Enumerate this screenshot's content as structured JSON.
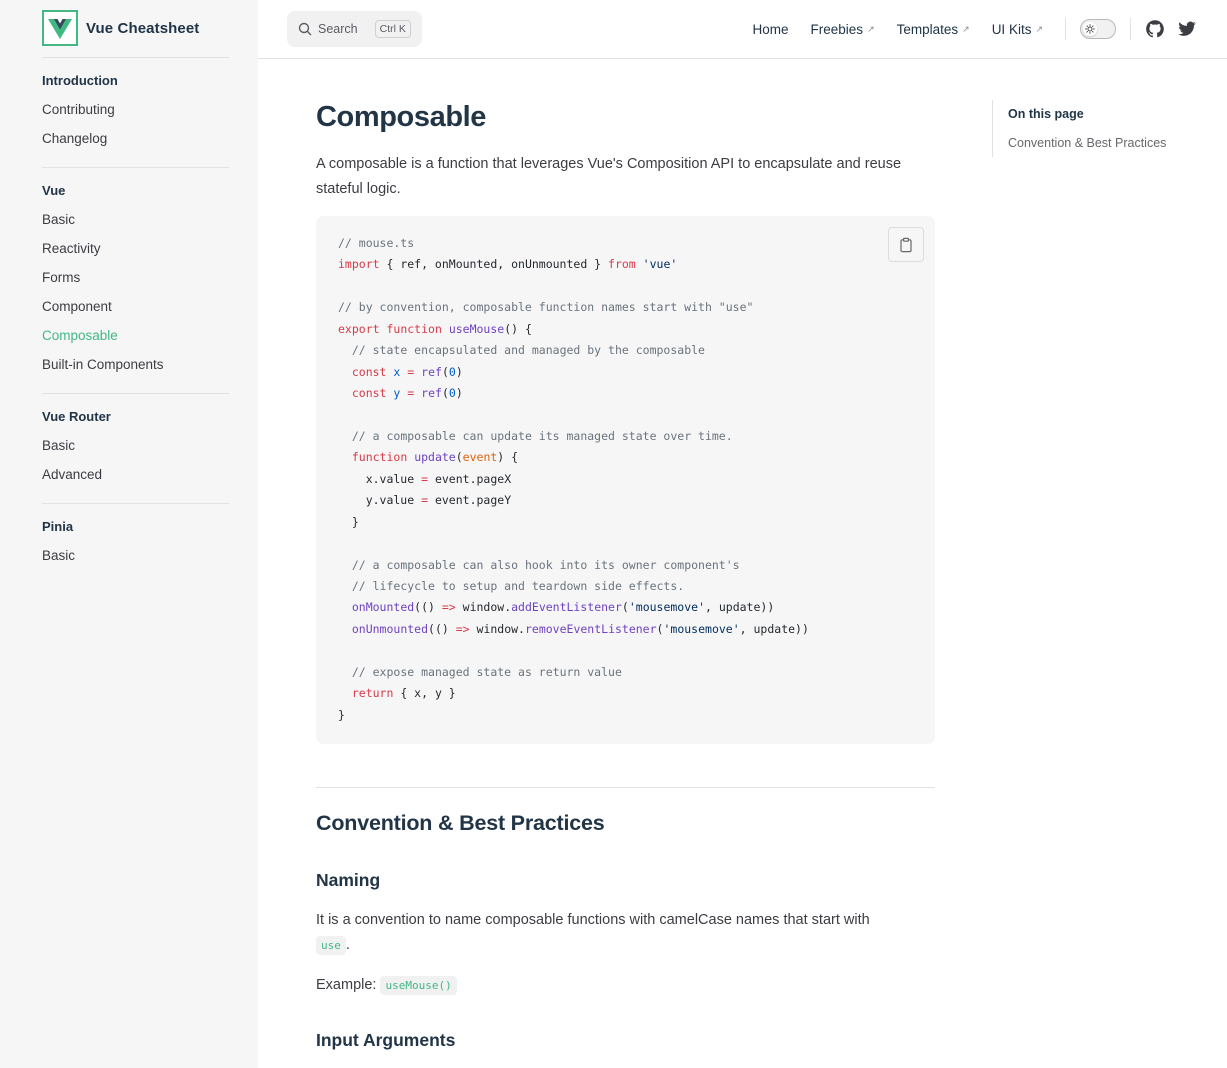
{
  "site": {
    "name": "Vue Cheatsheet",
    "brand_color": "#42b883",
    "brand_dark": "#35495e"
  },
  "sidebar": {
    "groups": [
      {
        "title": "Introduction",
        "items": [
          {
            "label": "Contributing",
            "active": false
          },
          {
            "label": "Changelog",
            "active": false
          }
        ]
      },
      {
        "title": "Vue",
        "items": [
          {
            "label": "Basic",
            "active": false
          },
          {
            "label": "Reactivity",
            "active": false
          },
          {
            "label": "Forms",
            "active": false
          },
          {
            "label": "Component",
            "active": false
          },
          {
            "label": "Composable",
            "active": true
          },
          {
            "label": "Built-in Components",
            "active": false
          }
        ]
      },
      {
        "title": "Vue Router",
        "items": [
          {
            "label": "Basic",
            "active": false
          },
          {
            "label": "Advanced",
            "active": false
          }
        ]
      },
      {
        "title": "Pinia",
        "items": [
          {
            "label": "Basic",
            "active": false
          }
        ]
      }
    ]
  },
  "topbar": {
    "search_label": "Search",
    "search_shortcut": "Ctrl K",
    "nav": [
      {
        "label": "Home",
        "external": false
      },
      {
        "label": "Freebies",
        "external": true
      },
      {
        "label": "Templates",
        "external": true
      },
      {
        "label": "UI Kits",
        "external": true
      }
    ],
    "external_glyph": "↗",
    "icons": [
      "sun-icon",
      "github-icon",
      "twitter-icon"
    ]
  },
  "main": {
    "title": "Composable",
    "lead": "A composable is a function that leverages Vue's Composition API to encapsulate and reuse stateful logic.",
    "code_lines": [
      [
        [
          "c",
          "// mouse.ts"
        ]
      ],
      [
        [
          "k",
          "import"
        ],
        [
          "p",
          " { ref, onMounted, onUnmounted } "
        ],
        [
          "k",
          "from"
        ],
        [
          "p",
          " "
        ],
        [
          "s",
          "'vue'"
        ]
      ],
      [],
      [
        [
          "c",
          "// by convention, composable function names start with \"use\""
        ]
      ],
      [
        [
          "k",
          "export"
        ],
        [
          "p",
          " "
        ],
        [
          "k",
          "function"
        ],
        [
          "p",
          " "
        ],
        [
          "f",
          "useMouse"
        ],
        [
          "p",
          "() {"
        ]
      ],
      [
        [
          "p",
          "  "
        ],
        [
          "c",
          "// state encapsulated and managed by the composable"
        ]
      ],
      [
        [
          "p",
          "  "
        ],
        [
          "k",
          "const"
        ],
        [
          "p",
          " "
        ],
        [
          "n",
          "x"
        ],
        [
          "p",
          " "
        ],
        [
          "k",
          "="
        ],
        [
          "p",
          " "
        ],
        [
          "f",
          "ref"
        ],
        [
          "p",
          "("
        ],
        [
          "n",
          "0"
        ],
        [
          "p",
          ")"
        ]
      ],
      [
        [
          "p",
          "  "
        ],
        [
          "k",
          "const"
        ],
        [
          "p",
          " "
        ],
        [
          "n",
          "y"
        ],
        [
          "p",
          " "
        ],
        [
          "k",
          "="
        ],
        [
          "p",
          " "
        ],
        [
          "f",
          "ref"
        ],
        [
          "p",
          "("
        ],
        [
          "n",
          "0"
        ],
        [
          "p",
          ")"
        ]
      ],
      [],
      [
        [
          "p",
          "  "
        ],
        [
          "c",
          "// a composable can update its managed state over time."
        ]
      ],
      [
        [
          "p",
          "  "
        ],
        [
          "k",
          "function"
        ],
        [
          "p",
          " "
        ],
        [
          "f",
          "update"
        ],
        [
          "p",
          "("
        ],
        [
          "v",
          "event"
        ],
        [
          "p",
          ") {"
        ]
      ],
      [
        [
          "p",
          "    x.value "
        ],
        [
          "k",
          "="
        ],
        [
          "p",
          " event.pageX"
        ]
      ],
      [
        [
          "p",
          "    y.value "
        ],
        [
          "k",
          "="
        ],
        [
          "p",
          " event.pageY"
        ]
      ],
      [
        [
          "p",
          "  }"
        ]
      ],
      [],
      [
        [
          "p",
          "  "
        ],
        [
          "c",
          "// a composable can also hook into its owner component's"
        ]
      ],
      [
        [
          "p",
          "  "
        ],
        [
          "c",
          "// lifecycle to setup and teardown side effects."
        ]
      ],
      [
        [
          "p",
          "  "
        ],
        [
          "f",
          "onMounted"
        ],
        [
          "p",
          "(() "
        ],
        [
          "k",
          "=>"
        ],
        [
          "p",
          " window."
        ],
        [
          "f",
          "addEventListener"
        ],
        [
          "p",
          "("
        ],
        [
          "s",
          "'mousemove'"
        ],
        [
          "p",
          ", update))"
        ]
      ],
      [
        [
          "p",
          "  "
        ],
        [
          "f",
          "onUnmounted"
        ],
        [
          "p",
          "(() "
        ],
        [
          "k",
          "=>"
        ],
        [
          "p",
          " window."
        ],
        [
          "f",
          "removeEventListener"
        ],
        [
          "p",
          "("
        ],
        [
          "s",
          "'mousemove'"
        ],
        [
          "p",
          ", update))"
        ]
      ],
      [],
      [
        [
          "p",
          "  "
        ],
        [
          "c",
          "// expose managed state as return value"
        ]
      ],
      [
        [
          "p",
          "  "
        ],
        [
          "k",
          "return"
        ],
        [
          "p",
          " { x, y }"
        ]
      ],
      [
        [
          "p",
          "}"
        ]
      ]
    ],
    "section_title": "Convention & Best Practices",
    "naming_title": "Naming",
    "naming_text": "It is a convention to name composable functions with camelCase names that start with",
    "naming_code": "use",
    "naming_suffix": ".",
    "example_label": "Example:",
    "example_code": "useMouse()",
    "input_title": "Input Arguments"
  },
  "aside": {
    "title": "On this page",
    "links": [
      "Convention & Best Practices"
    ]
  }
}
